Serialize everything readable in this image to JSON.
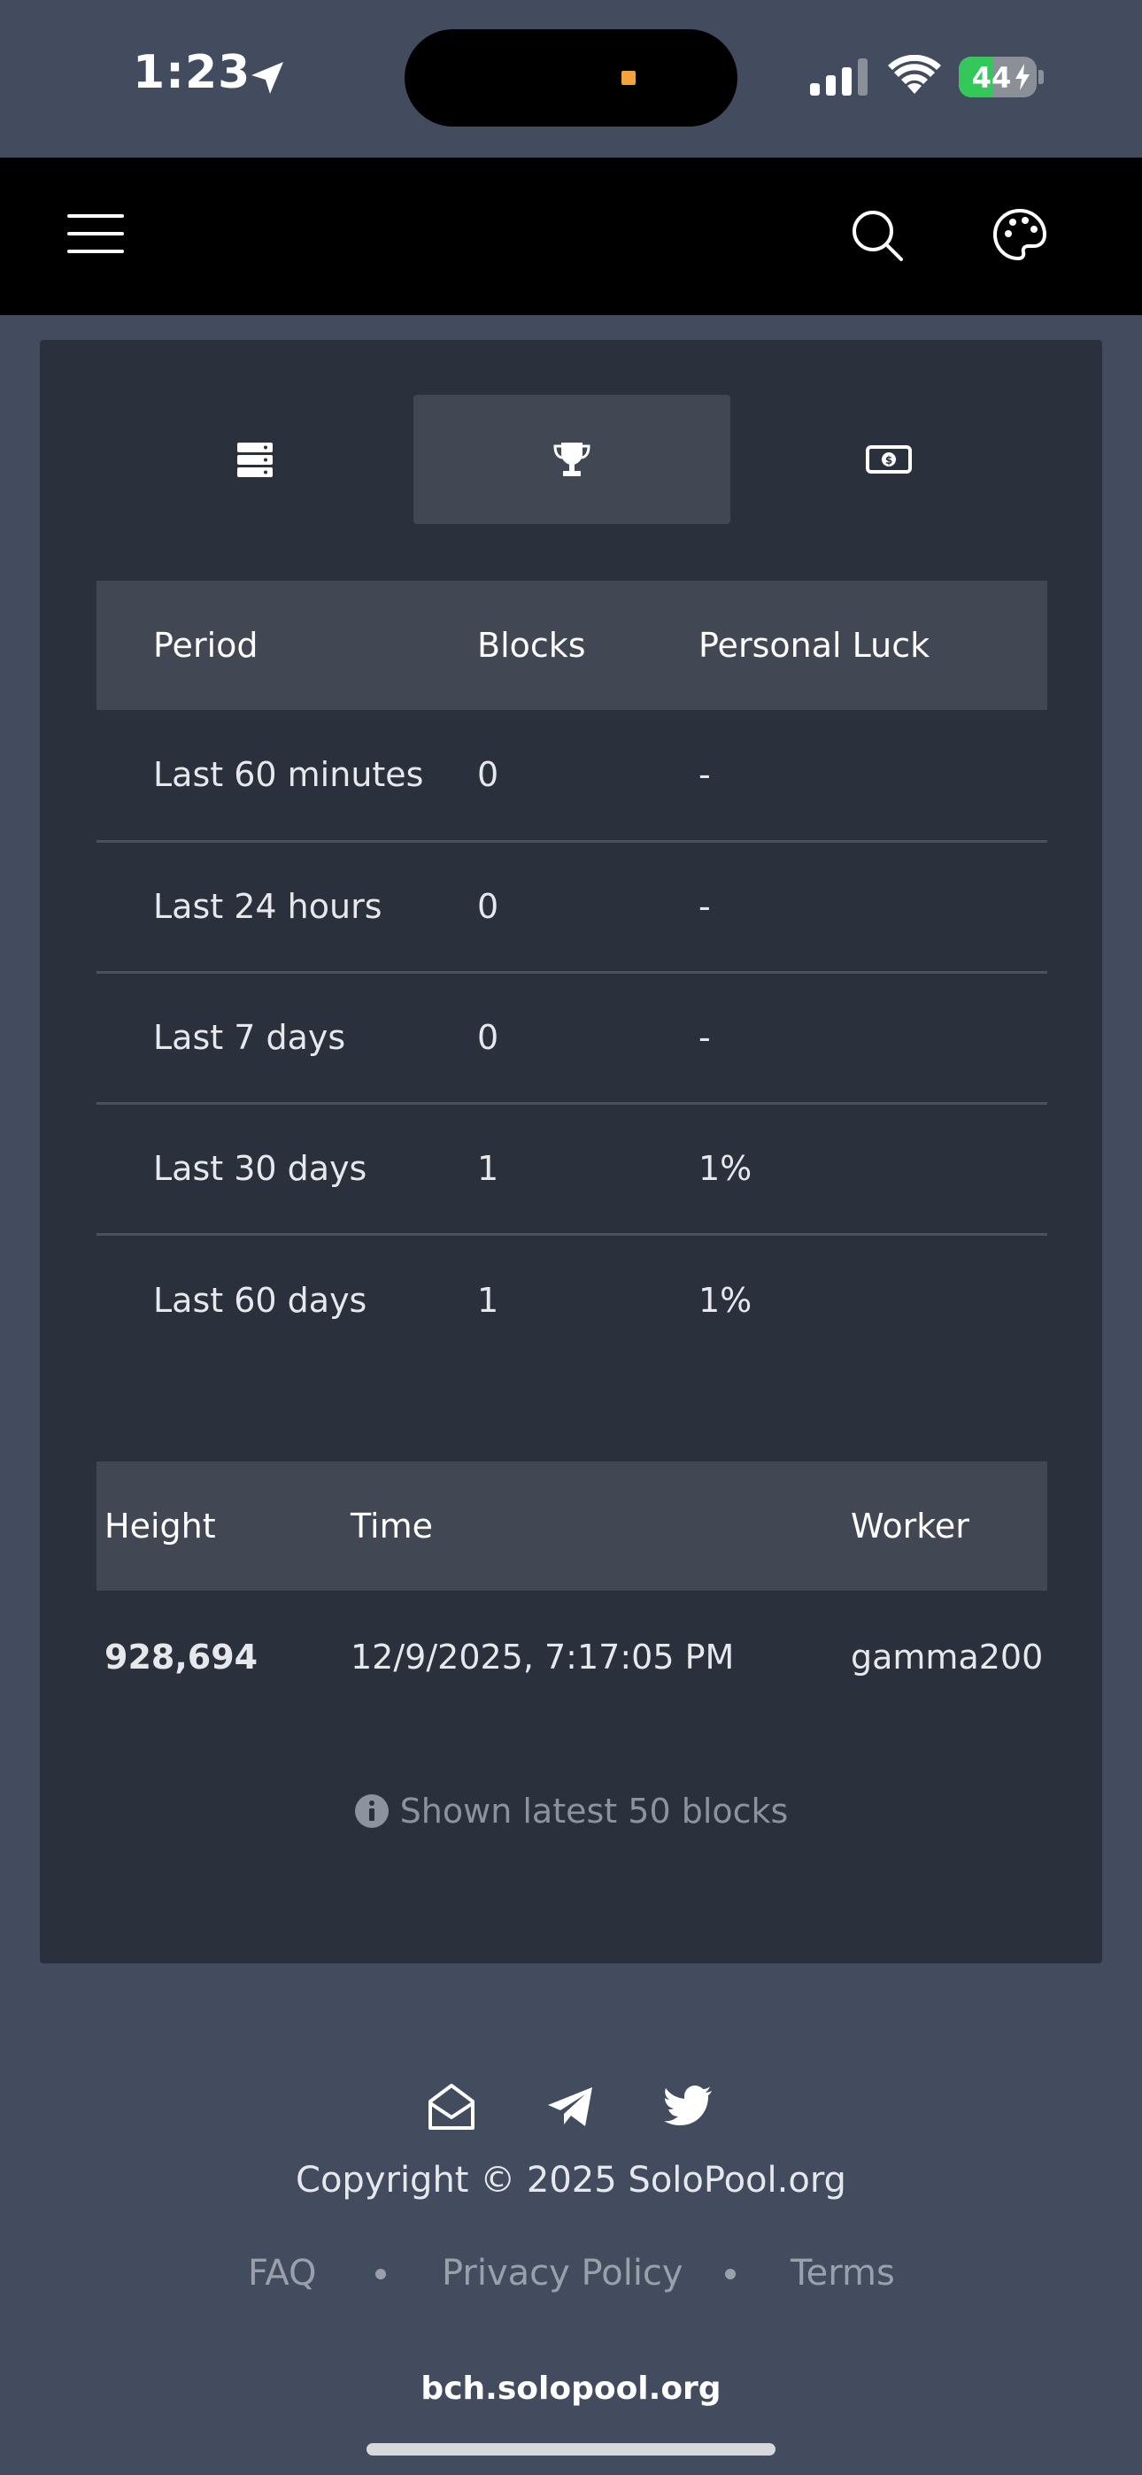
{
  "status_bar": {
    "time": "1:23",
    "battery": "44",
    "battery_level": 0.44,
    "battery_color": "#34c759"
  },
  "navbar": {
    "menu_icon": "hamburger-icon",
    "search_icon": "search-icon",
    "theme_icon": "palette-icon"
  },
  "tabs": [
    {
      "icon": "server-icon",
      "active": false
    },
    {
      "icon": "trophy-icon",
      "active": true
    },
    {
      "icon": "money-bill-icon",
      "active": false
    }
  ],
  "luck_table": {
    "headers": [
      "Period",
      "Blocks",
      "Personal Luck"
    ],
    "rows": [
      [
        "Last 60 minutes",
        "0",
        "-"
      ],
      [
        "Last 24 hours",
        "0",
        "-"
      ],
      [
        "Last 7 days",
        "0",
        "-"
      ],
      [
        "Last 30 days",
        "1",
        "1%"
      ],
      [
        "Last 60 days",
        "1",
        "1%"
      ]
    ]
  },
  "blocks_table": {
    "headers": [
      "Height",
      "Time",
      "Worker"
    ],
    "rows": [
      [
        "928,694",
        "12/9/2025, 7:17:05 PM",
        "gamma200"
      ]
    ]
  },
  "note": "Shown latest 50 blocks",
  "footer": {
    "icons": [
      "envelope-open-icon",
      "telegram-icon",
      "twitter-icon"
    ],
    "copyright": "Copyright © 2025 SoloPool.org",
    "links": [
      "FAQ",
      "Privacy Policy",
      "Terms"
    ],
    "domain": "bch.solopool.org"
  },
  "colors": {
    "page_bg": "#424c5e",
    "card_bg": "#2a303c",
    "header_row_bg": "#424754",
    "navbar_bg": "#000000"
  }
}
